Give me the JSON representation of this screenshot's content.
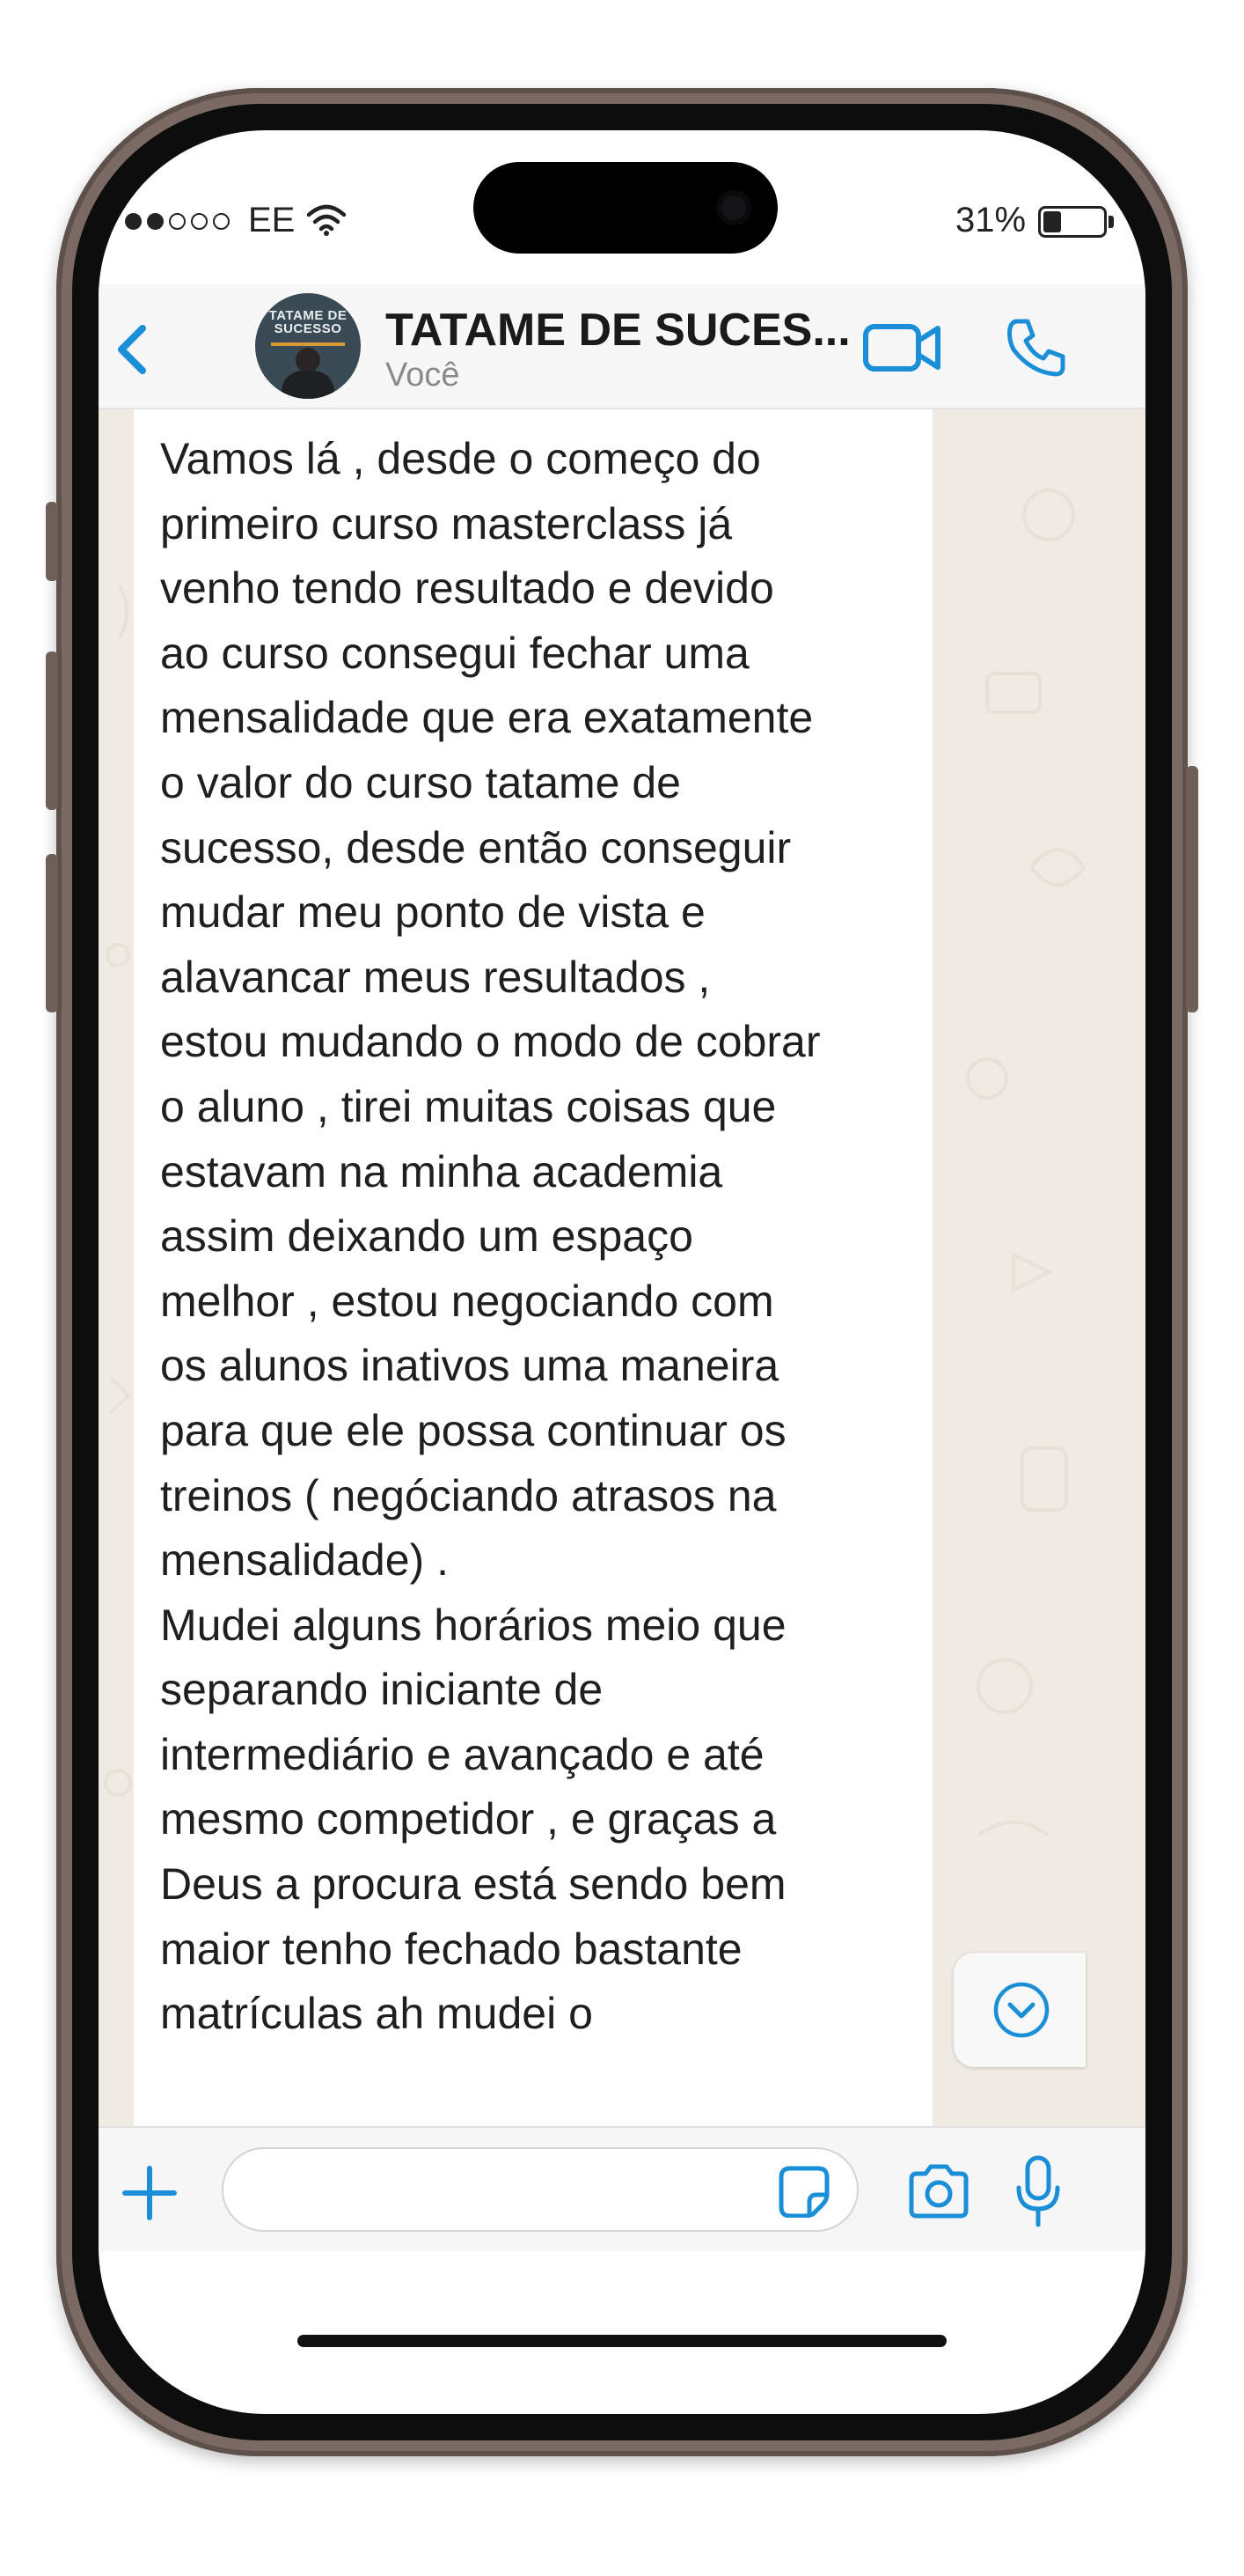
{
  "status_bar": {
    "carrier": "EE",
    "signal_bars_filled": 2,
    "signal_bars_total": 5,
    "battery_percent": "31%",
    "battery_level": 0.31
  },
  "header": {
    "title": "TATAME DE SUCES...",
    "subtitle": "Você",
    "avatar_text_line1": "TATAME DE",
    "avatar_text_line2": "SUCESSO"
  },
  "message": {
    "text": "Vamos lá , desde o começo do\nprimeiro curso masterclass já\nvenho tendo resultado e devido\nao  curso consegui fechar uma\nmensalidade que era exatamente\no valor do curso tatame de\nsucesso, desde então conseguir\nmudar meu ponto de vista e\nalavancar meus resultados ,\nestou mudando o modo de cobrar\no aluno , tirei muitas coisas que\nestavam na minha academia\nassim deixando um espaço\nmelhor , estou negociando com\nos alunos inativos uma maneira\npara que ele possa continuar os\ntreinos ( negóciando atrasos na\nmensalidade) .\nMudei alguns horários meio que\nseparando iniciante de\nintermediário e avançado e até\nmesmo competidor , e graças a\nDeus a procura está sendo bem\nmaior tenho fechado bastante\nmatrículas ah mudei o"
  },
  "input_bar": {
    "placeholder": "",
    "value": ""
  },
  "icons": {
    "back": "chevron-left-icon",
    "video": "video-camera-icon",
    "call": "phone-icon",
    "scroll": "chevron-down-circle-icon",
    "attach": "plus-icon",
    "sticker": "sticker-icon",
    "camera": "camera-icon",
    "mic": "microphone-icon",
    "wifi": "wifi-icon"
  },
  "colors": {
    "accent": "#1a8fd8",
    "chat_background": "#efeae2",
    "bubble": "#ffffff",
    "header_background": "#f7f7f7"
  }
}
